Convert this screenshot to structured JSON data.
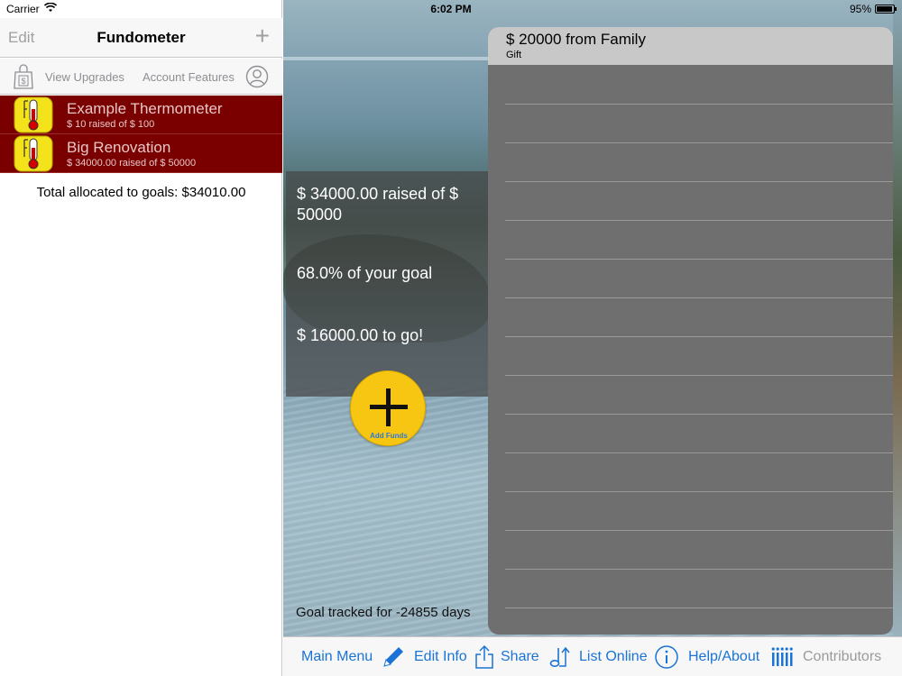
{
  "status_bar": {
    "carrier": "Carrier",
    "time": "6:02 PM",
    "battery": "95%",
    "battery_level": 0.95
  },
  "master": {
    "edit_label": "Edit",
    "title": "Fundometer",
    "add_icon": "plus-icon",
    "toolbar": {
      "upgrades_label": "View Upgrades",
      "account_label": "Account Features",
      "upgrades_icon": "shopping-bag-dollar-icon",
      "account_icon": "person-circle-icon"
    },
    "goals": [
      {
        "name": "Example Thermometer",
        "subtitle": "$ 10 raised of $ 100"
      },
      {
        "name": "Big Renovation",
        "subtitle": "$ 34000.00 raised of $ 50000"
      }
    ],
    "total_allocated": "Total allocated to goals: $34010.00"
  },
  "detail": {
    "raised_text": "$ 34000.00 raised of $ 50000",
    "percent_text": "68.0% of your goal",
    "to_go_text": "$ 16000.00 to go!",
    "add_funds_label": "Add Funds",
    "tracked_text": "Goal tracked for -24855 days",
    "contributions": [
      {
        "amount": "$ 20000 from Family",
        "kind": "Gift"
      }
    ]
  },
  "tabbar": {
    "items": [
      {
        "label": "Main Menu",
        "icon": ""
      },
      {
        "label": "Edit Info",
        "icon": "pencil-icon"
      },
      {
        "label": "Share",
        "icon": "share-icon"
      },
      {
        "label": "List Online",
        "icon": "upload-note-icon"
      },
      {
        "label": "Help/About",
        "icon": "info-icon"
      },
      {
        "label": "Contributors",
        "icon": "contributors-icon"
      }
    ]
  },
  "colors": {
    "accent": "#1a73d6",
    "goal_row": "#7a0000",
    "add_button": "#f7c613",
    "panel": "#6f6f6f"
  }
}
